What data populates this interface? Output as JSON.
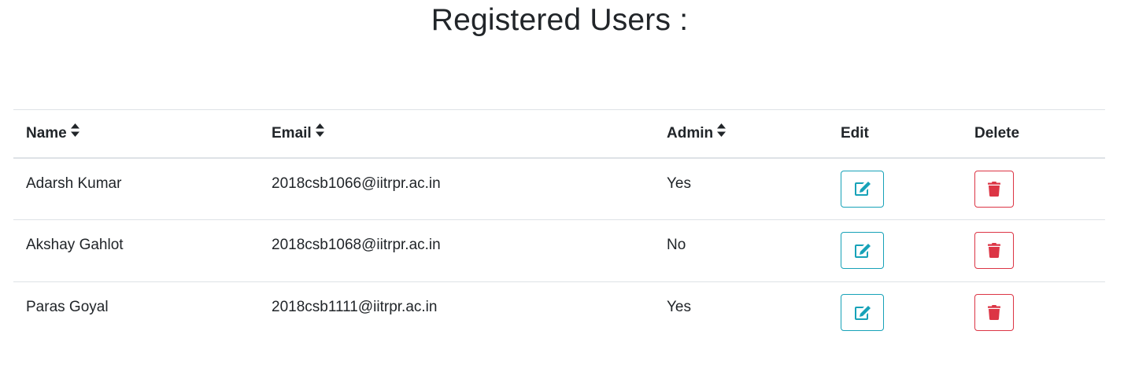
{
  "page": {
    "title": "Registered Users :"
  },
  "table": {
    "headers": {
      "name": "Name",
      "email": "Email",
      "admin": "Admin",
      "edit": "Edit",
      "delete": "Delete"
    },
    "rows": [
      {
        "name": "Adarsh Kumar",
        "email": "2018csb1066@iitrpr.ac.in",
        "admin": "Yes"
      },
      {
        "name": "Akshay Gahlot",
        "email": "2018csb1068@iitrpr.ac.in",
        "admin": "No"
      },
      {
        "name": "Paras Goyal",
        "email": "2018csb1111@iitrpr.ac.in",
        "admin": "Yes"
      }
    ]
  },
  "icons": {
    "sort": "sort-icon",
    "edit": "edit-icon",
    "delete": "trash-icon"
  },
  "colors": {
    "edit_accent": "#17a2b8",
    "delete_accent": "#dc3545",
    "text": "#212529",
    "border": "#dee2e6"
  }
}
